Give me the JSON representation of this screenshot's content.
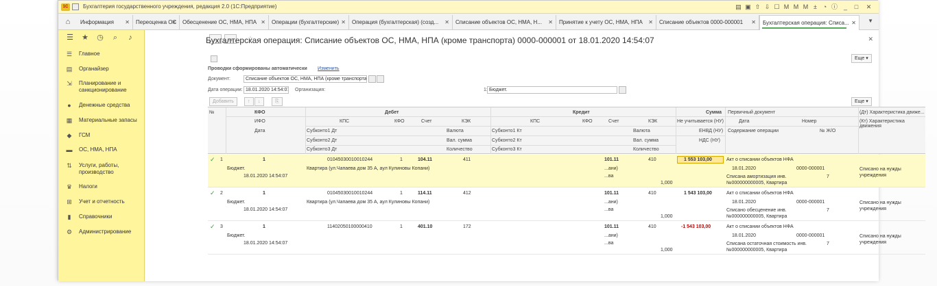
{
  "window": {
    "title": "Бухгалтерия государственного учреждения, редакция 2.0 (1С:Предприятие)",
    "logo": "1С"
  },
  "tabs": [
    {
      "label": "Информация"
    },
    {
      "label": "Переоценка ОС"
    },
    {
      "label": "Обесценение ОС, НМА, НПА"
    },
    {
      "label": "Операции (бухгалтерские)"
    },
    {
      "label": "Операция (бухгалтерская) (созд..."
    },
    {
      "label": "Списание объектов ОС, НМА, Н..."
    },
    {
      "label": "Принятие к учету ОС, НМА, НПА"
    },
    {
      "label": "Списание объектов 0000-000001"
    },
    {
      "label": "Бухгалтерская операция: Списа..."
    }
  ],
  "sidebar": {
    "items": [
      {
        "icon": "☰",
        "label": "Главное"
      },
      {
        "icon": "▤",
        "label": "Органайзер"
      },
      {
        "icon": "⇲",
        "label": "Планирование и санкционирование"
      },
      {
        "icon": "●",
        "label": "Денежные средства"
      },
      {
        "icon": "▦",
        "label": "Материальные запасы"
      },
      {
        "icon": "◆",
        "label": "ГСМ"
      },
      {
        "icon": "▬",
        "label": "ОС, НМА, НПА"
      },
      {
        "icon": "⇅",
        "label": "Услуги, работы, производство"
      },
      {
        "icon": "♛",
        "label": "Налоги"
      },
      {
        "icon": "⊞",
        "label": "Учет и отчетность"
      },
      {
        "icon": "▮",
        "label": "Справочники"
      },
      {
        "icon": "⚙",
        "label": "Администрирование"
      }
    ]
  },
  "document": {
    "title": "Бухгалтерская операция: Списание объектов ОС, НМА, НПА (кроме транспорта) 0000-000001 от 18.01.2020 14:54:07",
    "more_label": "Еще",
    "auto_text": "Проводки сформированы автоматически",
    "change_link": "Изменить",
    "doc_label": "Документ:",
    "doc_value": "Списание объектов ОС, НМА, НПА (кроме транспорта)",
    "date_label": "Дата операции:",
    "date_value": "18.01.2020 14:54:07",
    "org_label": "Организация:",
    "budget_prefix": "1:",
    "budget_value": "Бюджет.",
    "add_label": "Добавить",
    "more2_label": "Еще"
  },
  "table": {
    "headers": {
      "num": "№",
      "kfo": "КФО",
      "ifo": "ИФО",
      "date": "Дата",
      "debit": "Дебет",
      "d_kps": "КПС",
      "d_kfo": "КФО",
      "d_acc": "Счет",
      "d_kek": "КЭК",
      "d_sub1": "Субконто1 Дт",
      "d_sub2": "Субконто2 Дт",
      "d_sub3": "Субконто3 Дт",
      "d_cur": "Валюта",
      "d_cursum": "Вал. сумма",
      "d_qty": "Количество",
      "credit": "Кредит",
      "c_kps": "КПС",
      "c_kfo": "КФО",
      "c_acc": "Счет",
      "c_kek": "КЭК",
      "c_sub1": "Субконто1 Кт",
      "c_sub2": "Субконто2 Кт",
      "c_sub3": "Субконто3 Кт",
      "c_cur": "Валюта",
      "c_cursum": "Вал. сумма",
      "c_qty": "Количество",
      "sum": "Сумма",
      "sum_nu": "Не учитывается (НУ)",
      "envd": "ЕНВД (НУ)",
      "nds": "НДС (НУ)",
      "primary": "Первичный документ",
      "p_date": "Дата",
      "p_num": "Номер",
      "p_content": "Содержание операции",
      "p_jo": "№ Ж/О",
      "dt_char": "(Дт) Характеристика движе...",
      "kt_char": "(Кт) Характеристика движения"
    },
    "rows": [
      {
        "n": "1",
        "kfo": "1",
        "budget": "Бюджет.",
        "date": "18.01.2020 14:54:07",
        "d_kps": "01045030010010244",
        "d_kfo": "1",
        "d_acc": "104.11",
        "d_kek": "411",
        "d_sub1": "Квартира (ул.Чапаева дом 35 А, аул Кулиновы Копани)",
        "c_acc": "101.11",
        "c_kek": "410",
        "c_sub1": "...ани)",
        "c_sub2": "...ва",
        "qty": "1,000",
        "sum": "1 553 103,00",
        "p_title": "Акт о списании объектов НФА",
        "p_date": "18.01.2020",
        "p_num": "0000-000001",
        "p_content": "Списана амортизация инв. №000000000005, Квартира",
        "p_jo": "7",
        "char": "Списано на нужды учреждения"
      },
      {
        "n": "2",
        "kfo": "1",
        "budget": "Бюджет.",
        "date": "18.01.2020 14:54:07",
        "d_kps": "01045030010010244",
        "d_kfo": "1",
        "d_acc": "114.11",
        "d_kek": "412",
        "d_sub1": "Квартира (ул.Чапаева дом 35 А, аул Кулиновы Копани)",
        "c_acc": "101.11",
        "c_kek": "410",
        "c_sub1": "...ани)",
        "c_sub2": "...ва",
        "qty": "1,000",
        "sum": "1 543 103,00",
        "p_title": "Акт о списании объектов НФА",
        "p_date": "18.01.2020",
        "p_num": "0000-000001",
        "p_content": "Списано обесценение инв. №000000000005, Квартира",
        "p_jo": "7",
        "char": "Списано на нужды учреждения"
      },
      {
        "n": "3",
        "kfo": "1",
        "budget": "Бюджет.",
        "date": "18.01.2020 14:54:07",
        "d_kps": "11402050100000410",
        "d_kfo": "1",
        "d_acc": "401.10",
        "d_kek": "172",
        "d_sub1": "",
        "c_acc": "101.11",
        "c_kek": "410",
        "c_sub1": "...ани)",
        "c_sub2": "...ва",
        "qty": "1,000",
        "sum": "-1 543 103,00",
        "p_title": "Акт о списании объектов НФА",
        "p_date": "18.01.2020",
        "p_num": "0000-000001",
        "p_content": "Списана остаточная стоимость инв. №000000000005, Квартира",
        "p_jo": "7",
        "char": "Списано на нужды учреждения"
      }
    ]
  }
}
